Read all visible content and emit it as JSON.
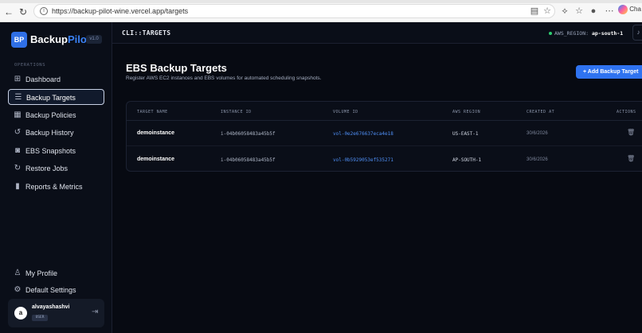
{
  "browser": {
    "url": "https://backup-pilot-wine.vercel.app/targets",
    "copilot_label": "Cha"
  },
  "brand": {
    "badge": "BP",
    "name_main": "Backup",
    "name_accent": "Pilot",
    "version": "v1.0"
  },
  "sidebar": {
    "section_label": "OPERATIONS",
    "items": [
      {
        "label": "Dashboard",
        "icon": "grid-icon"
      },
      {
        "label": "Backup Targets",
        "icon": "server-icon"
      },
      {
        "label": "Backup Policies",
        "icon": "calendar-icon"
      },
      {
        "label": "Backup History",
        "icon": "history-icon"
      },
      {
        "label": "EBS Snapshots",
        "icon": "camera-icon"
      },
      {
        "label": "Restore Jobs",
        "icon": "restore-icon"
      },
      {
        "label": "Reports & Metrics",
        "icon": "chart-icon"
      }
    ],
    "bottom_items": [
      {
        "label": "My Profile",
        "icon": "user-icon"
      },
      {
        "label": "Default Settings",
        "icon": "gear-icon"
      }
    ],
    "user": {
      "initial": "a",
      "name": "alvayashashvi",
      "role": "USER"
    }
  },
  "topbar": {
    "title": "CLI::TARGETS",
    "region_label": "AWS_REGION:",
    "region_value": "ap-south-1"
  },
  "main": {
    "title": "EBS Backup Targets",
    "subtitle": "Register AWS EC2 instances and EBS volumes for automated scheduling snapshots.",
    "add_button": "+ Add Backup Target"
  },
  "table": {
    "headers": [
      "TARGET NAME",
      "INSTANCE ID",
      "VOLUME ID",
      "AWS REGION",
      "CREATED AT",
      "ACTIONS"
    ],
    "rows": [
      {
        "name": "demoinstance",
        "instance": "i-04b06058483a45b5f",
        "volume": "vol-0e2e676637eca4e18",
        "region": "US-EAST-1",
        "created": "30/6/2026"
      },
      {
        "name": "demoinstance",
        "instance": "i-04b06058483a45b5f",
        "volume": "vol-0b5929053ef535271",
        "region": "AP-SOUTH-1",
        "created": "30/6/2026"
      }
    ]
  },
  "colors": {
    "accent": "#2f73f0",
    "background": "#070a12",
    "link": "#4f8ff5"
  }
}
